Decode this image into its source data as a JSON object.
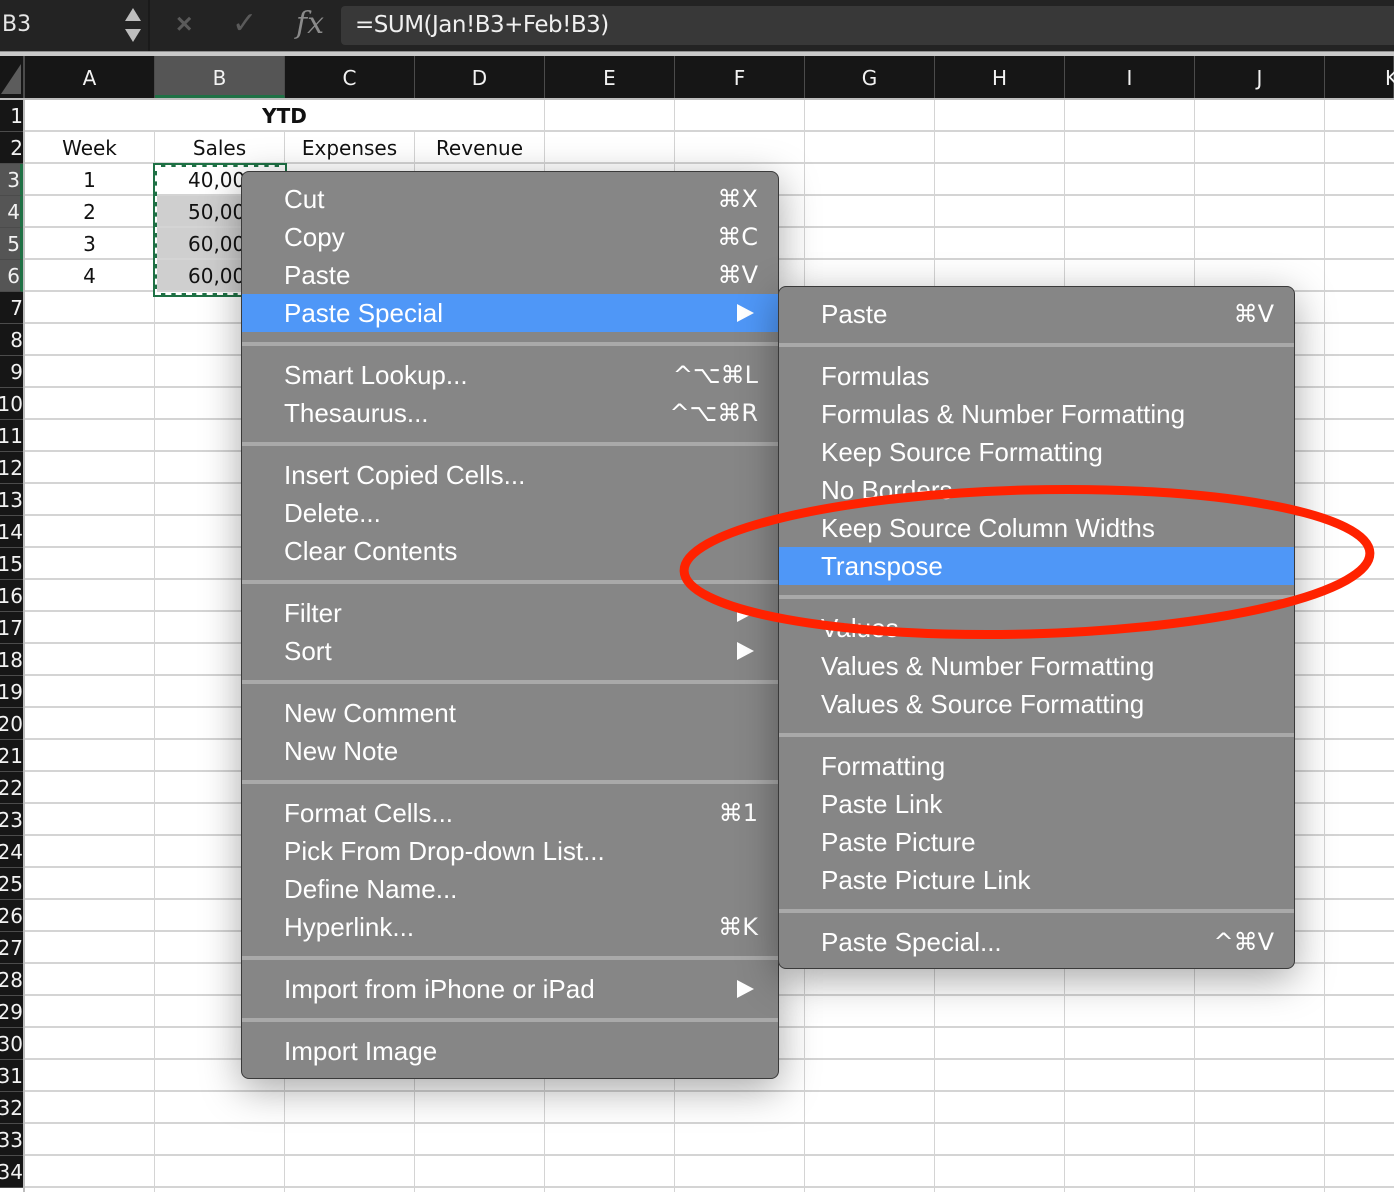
{
  "formula_bar": {
    "name_box": "B3",
    "cancel_icon": "×",
    "enter_icon": "✓",
    "fx_label": "fx",
    "formula": "=SUM(Jan!B3+Feb!B3)"
  },
  "columns": [
    "A",
    "B",
    "C",
    "D",
    "E",
    "F",
    "G",
    "H",
    "I",
    "J",
    "K"
  ],
  "selected_column": "B",
  "rows": [
    "1",
    "2",
    "3",
    "4",
    "5",
    "6",
    "7",
    "8",
    "9",
    "10",
    "11",
    "12",
    "13",
    "14",
    "15",
    "16",
    "17",
    "18",
    "19",
    "20",
    "21",
    "22",
    "23",
    "24",
    "25",
    "26",
    "27",
    "28",
    "29",
    "30",
    "31",
    "32",
    "33",
    "34"
  ],
  "selected_rows": [
    "3",
    "4",
    "5",
    "6"
  ],
  "sheet": {
    "title": "YTD",
    "headers": [
      "Week",
      "Sales",
      "Expenses",
      "Revenue"
    ],
    "data_rows": [
      {
        "week": "1",
        "sales": "40,00"
      },
      {
        "week": "2",
        "sales": "50,00"
      },
      {
        "week": "3",
        "sales": "60,00"
      },
      {
        "week": "4",
        "sales": "60,00"
      }
    ]
  },
  "context_menu": {
    "groups": [
      [
        {
          "label": "Cut",
          "shortcut": "⌘X"
        },
        {
          "label": "Copy",
          "shortcut": "⌘C"
        },
        {
          "label": "Paste",
          "shortcut": "⌘V"
        },
        {
          "label": "Paste Special",
          "submenu": true,
          "highlighted": true
        }
      ],
      [
        {
          "label": "Smart Lookup...",
          "shortcut": "^⌥⌘L"
        },
        {
          "label": "Thesaurus...",
          "shortcut": "^⌥⌘R"
        }
      ],
      [
        {
          "label": "Insert Copied Cells..."
        },
        {
          "label": "Delete..."
        },
        {
          "label": "Clear Contents"
        }
      ],
      [
        {
          "label": "Filter",
          "submenu": true
        },
        {
          "label": "Sort",
          "submenu": true
        }
      ],
      [
        {
          "label": "New Comment"
        },
        {
          "label": "New Note"
        }
      ],
      [
        {
          "label": "Format Cells...",
          "shortcut": "⌘1"
        },
        {
          "label": "Pick From Drop-down List..."
        },
        {
          "label": "Define Name..."
        },
        {
          "label": "Hyperlink...",
          "shortcut": "⌘K"
        }
      ],
      [
        {
          "label": "Import from iPhone or iPad",
          "submenu": true
        }
      ],
      [
        {
          "label": "Import Image"
        }
      ]
    ]
  },
  "paste_special_submenu": {
    "groups": [
      [
        {
          "label": "Paste",
          "shortcut": "⌘V"
        }
      ],
      [
        {
          "label": "Formulas"
        },
        {
          "label": "Formulas & Number Formatting"
        },
        {
          "label": "Keep Source Formatting"
        },
        {
          "label": "No Borders"
        },
        {
          "label": "Keep Source Column Widths"
        },
        {
          "label": "Transpose",
          "highlighted": true
        }
      ],
      [
        {
          "label": "Values"
        },
        {
          "label": "Values & Number Formatting"
        },
        {
          "label": "Values & Source Formatting"
        }
      ],
      [
        {
          "label": "Formatting"
        },
        {
          "label": "Paste Link"
        },
        {
          "label": "Paste Picture"
        },
        {
          "label": "Paste Picture Link"
        }
      ],
      [
        {
          "label": "Paste Special...",
          "shortcut": "^⌘V"
        }
      ]
    ]
  },
  "colors": {
    "menu_bg": "#868686",
    "highlight": "#4f97f7",
    "annotation": "#ff2200",
    "selection_border": "#1f7145"
  }
}
